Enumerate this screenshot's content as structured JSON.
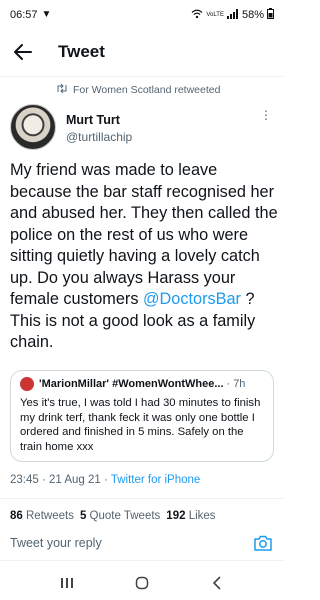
{
  "status": {
    "time": "06:57",
    "battery": "58%",
    "network": "VoLTE"
  },
  "header": {
    "title": "Tweet"
  },
  "retweet": {
    "text": "For Women Scotland retweeted"
  },
  "author": {
    "display_name": "Murt Turt",
    "handle": "@turtillachip"
  },
  "tweet": {
    "text_before": "My friend was made to leave because the bar staff recognised her and abused her. They then called the police on the rest of us who were sitting quietly having a lovely catch up. Do you always Harass your female customers ",
    "mention": "@DoctorsBar",
    "text_after": " ? This is not a good look as a family chain."
  },
  "quote": {
    "name": "'MarionMillar' #WomenWontWhee...",
    "dot": "·",
    "time": "7h",
    "text": "Yes it's true, I was told I had 30 minutes to finish my drink terf, thank feck it was only one bottle I ordered and finished in 5 mins. Safely on the train home xxx"
  },
  "meta": {
    "timestamp": "23:45 · 21 Aug 21 · ",
    "source": "Twitter for iPhone"
  },
  "stats": {
    "retweets_count": "86",
    "retweets_label": "Retweets",
    "quotes_count": "5",
    "quotes_label": "Quote Tweets",
    "likes_count": "192",
    "likes_label": "Likes"
  },
  "reply": {
    "placeholder": "Tweet your reply"
  },
  "colors": {
    "accent": "#1d9bf0",
    "muted": "#536471",
    "text": "#0f1419"
  }
}
